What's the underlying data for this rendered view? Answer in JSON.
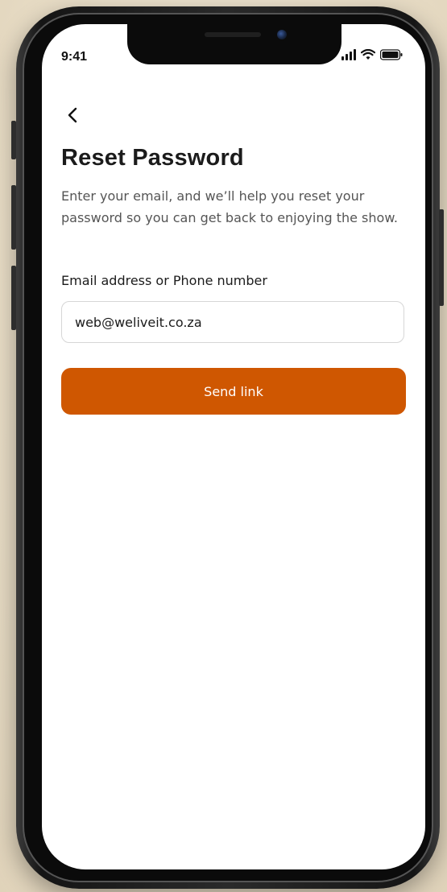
{
  "status_bar": {
    "time": "9:41",
    "icons": [
      "signal-icon",
      "wifi-icon",
      "battery-icon"
    ]
  },
  "nav": {
    "back_icon": "chevron-left-icon"
  },
  "header": {
    "title": "Reset Password",
    "description": "Enter your email, and we’ll help you reset your password so you can get back to enjoying the show."
  },
  "form": {
    "field_label": "Email address or Phone number",
    "email_value": "web@weliveit.co.za",
    "submit_label": "Send link"
  },
  "colors": {
    "accent": "#cf5701",
    "title": "#1b1b1b",
    "body_text": "#555555",
    "input_border": "#d6d6d6",
    "background": "#ffffff"
  }
}
